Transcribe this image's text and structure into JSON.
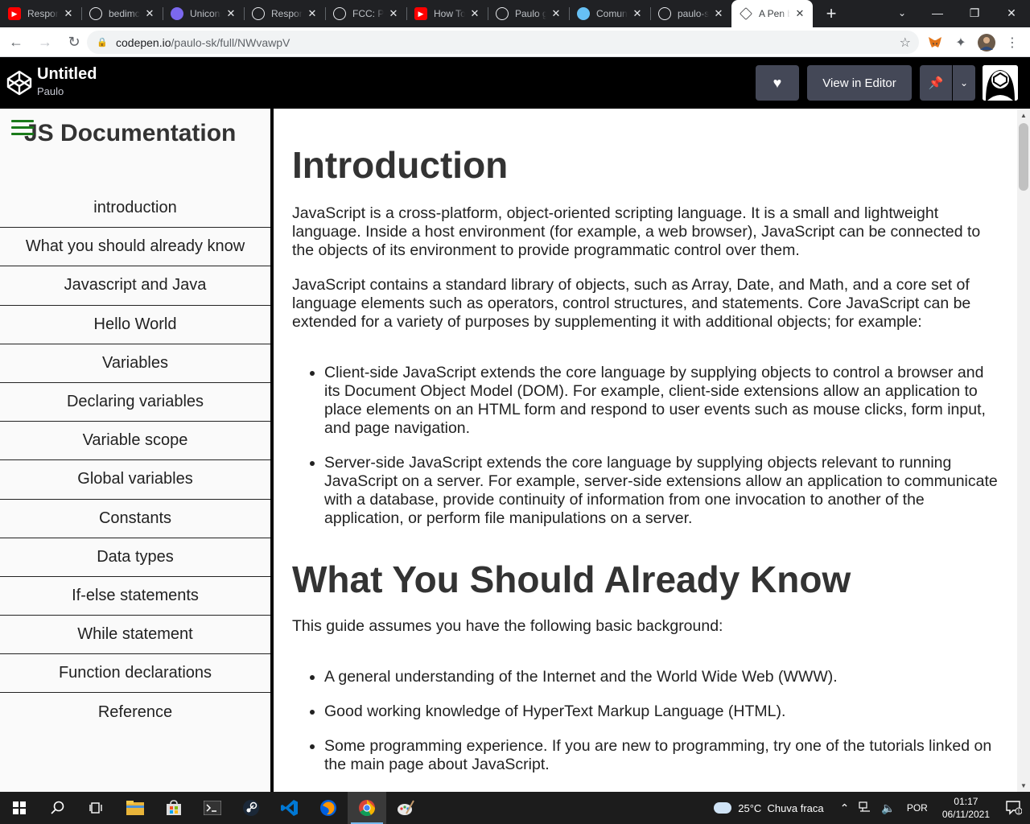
{
  "browser": {
    "tabs": [
      {
        "label": "Responsive",
        "favicon": "youtube-icon",
        "color": "#ff0000"
      },
      {
        "label": "bedimcode",
        "favicon": "github-icon",
        "color": "#e8eaed"
      },
      {
        "label": "Unicons",
        "favicon": "unicons-icon",
        "color": "#7b68ee"
      },
      {
        "label": "Responsive",
        "favicon": "a-icon",
        "color": "#e8eaed"
      },
      {
        "label": "FCC: Product",
        "favicon": "fcc-icon",
        "color": "#e8eaed"
      },
      {
        "label": "How To",
        "favicon": "youtube-icon",
        "color": "#ff0000"
      },
      {
        "label": "Paulo g",
        "favicon": "globe-icon",
        "color": "#e8eaed"
      },
      {
        "label": "Comunidade",
        "favicon": "steam-icon",
        "color": "#66c0f4"
      },
      {
        "label": "paulo-sk",
        "favicon": "github-icon",
        "color": "#e8eaed"
      },
      {
        "label": "A Pen by",
        "favicon": "codepen-icon",
        "color": "#202124"
      }
    ],
    "url_host": "codepen.io",
    "url_path": "/paulo-sk/full/NWvawpV"
  },
  "codepen": {
    "title": "Untitled",
    "author": "Paulo",
    "view_in_editor": "View in Editor"
  },
  "sidebar": {
    "title": "JS Documentation",
    "items": [
      "introduction",
      "What you should already know",
      "Javascript and Java",
      "Hello World",
      "Variables",
      "Declaring variables",
      "Variable scope",
      "Global variables",
      "Constants",
      "Data types",
      "If-else statements",
      "While statement",
      "Function declarations",
      "Reference"
    ]
  },
  "main": {
    "intro_title": "Introduction",
    "intro_p1": "JavaScript is a cross-platform, object-oriented scripting language. It is a small and lightweight language. Inside a host environment (for example, a web browser), JavaScript can be connected to the objects of its environment to provide programmatic control over them.",
    "intro_p2": "JavaScript contains a standard library of objects, such as Array, Date, and Math, and a core set of language elements such as operators, control structures, and statements. Core JavaScript can be extended for a variety of purposes by supplementing it with additional objects; for example:",
    "intro_list": [
      "Client-side JavaScript extends the core language by supplying objects to control a browser and its Document Object Model (DOM). For example, client-side extensions allow an application to place elements on an HTML form and respond to user events such as mouse clicks, form input, and page navigation.",
      "Server-side JavaScript extends the core language by supplying objects relevant to running JavaScript on a server. For example, server-side extensions allow an application to communicate with a database, provide continuity of information from one invocation to another of the application, or perform file manipulations on a server."
    ],
    "know_title": "What You Should Already Know",
    "know_p": "This guide assumes you have the following basic background:",
    "know_list": [
      "A general understanding of the Internet and the World Wide Web (WWW).",
      "Good working knowledge of HyperText Markup Language (HTML).",
      "Some programming experience. If you are new to programming, try one of the tutorials linked on the main page about JavaScript."
    ]
  },
  "taskbar": {
    "weather": "25°C  Chuva fraca",
    "language": "POR",
    "time": "01:17",
    "date": "06/11/2021",
    "notifications": "1"
  }
}
